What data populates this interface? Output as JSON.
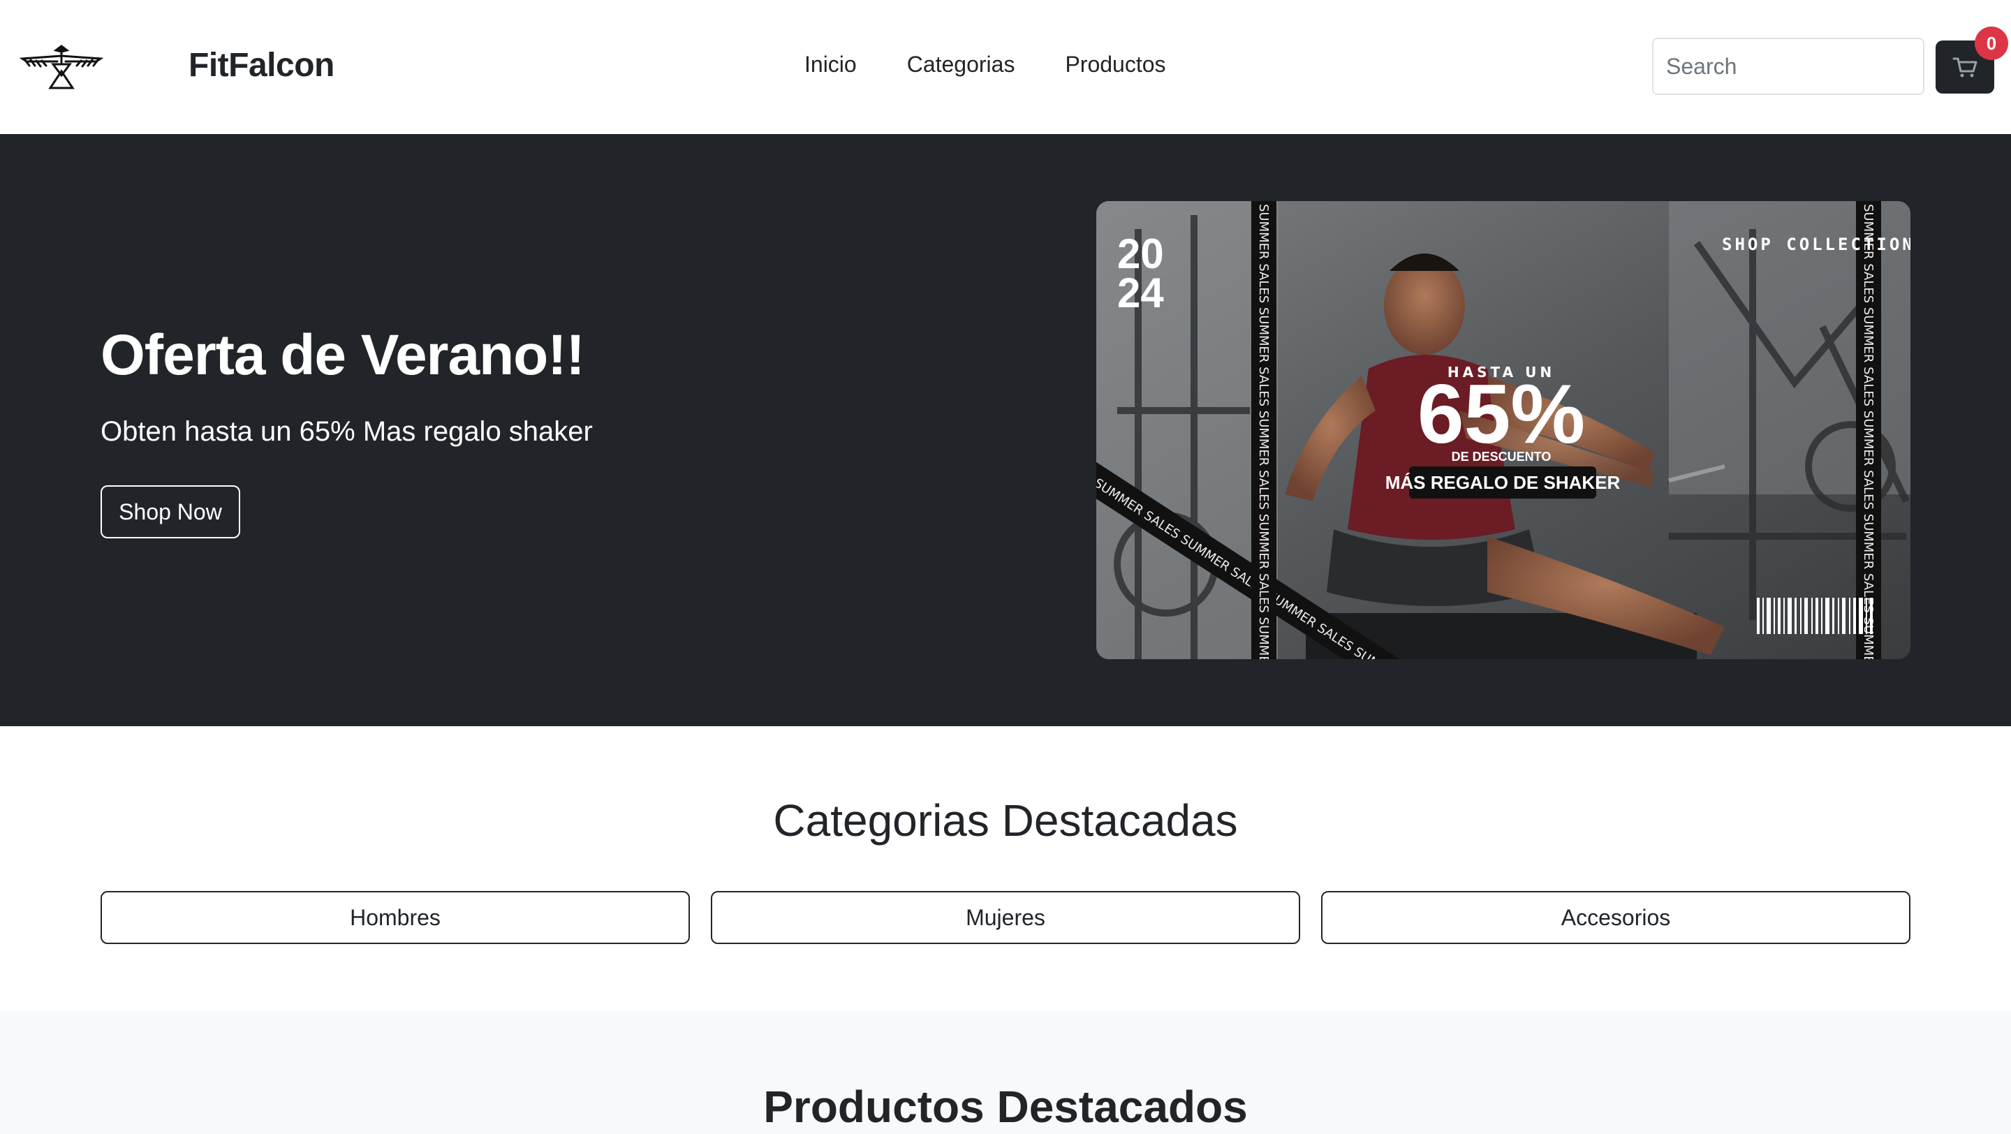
{
  "navbar": {
    "brand": "FitFalcon",
    "links": [
      "Inicio",
      "Categorias",
      "Productos"
    ],
    "search_placeholder": "Search",
    "cart_count": "0"
  },
  "hero": {
    "title": "Oferta de Verano!!",
    "subtitle": "Obten hasta un 65% Mas regalo shaker",
    "button": "Shop Now",
    "banner": {
      "year_top": "20",
      "year_bottom": "24",
      "collection": "SHOP COLLECTION",
      "hasta": "HASTA UN",
      "percent": "65%",
      "descuento": "DE DESCUENTO",
      "regalo": "MÁS REGALO DE SHAKER",
      "ribbon": "SUMMER SALES  SUMMER SALES  SUMMER SALES  SUMMER SALES  SUMMER SALES"
    }
  },
  "categories": {
    "title": "Categorias Destacadas",
    "items": [
      "Hombres",
      "Mujeres",
      "Accesorios"
    ]
  },
  "products": {
    "title": "Productos Destacados"
  }
}
